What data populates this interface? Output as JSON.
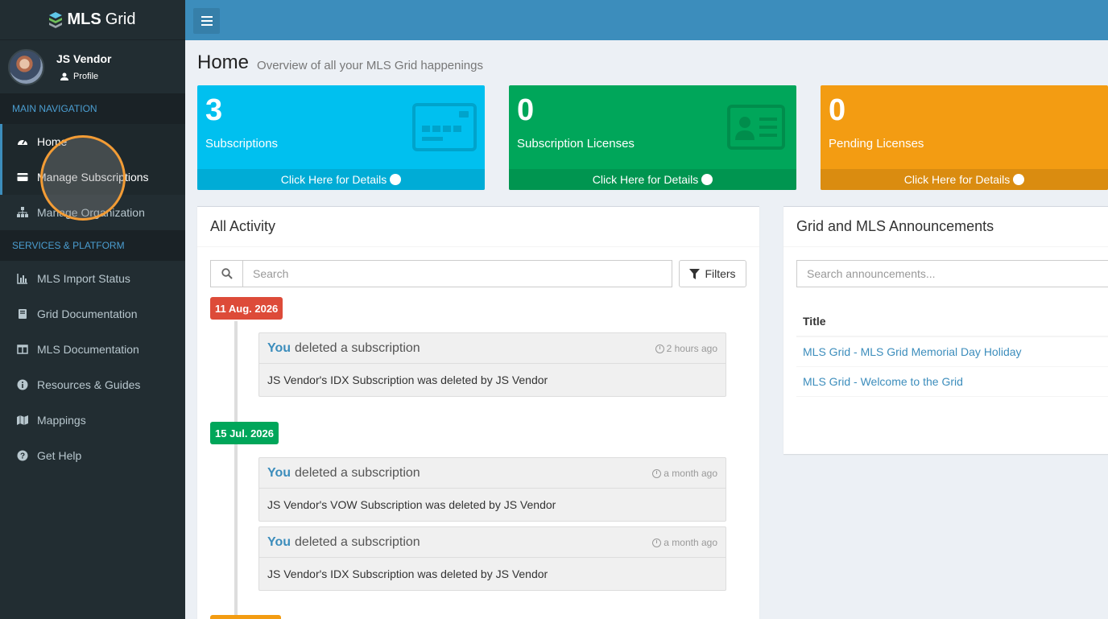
{
  "app": {
    "logo_bold": "MLS",
    "logo_rest": "Grid"
  },
  "user": {
    "name": "JS Vendor",
    "profile_label": "Profile"
  },
  "sidebar": {
    "main_header": "MAIN NAVIGATION",
    "main_items": [
      {
        "label": "Home",
        "icon": "dashboard-icon"
      },
      {
        "label": "Manage Subscriptions",
        "icon": "credit-card-icon"
      },
      {
        "label": "Manage Organization",
        "icon": "sitemap-icon"
      }
    ],
    "services_header": "SERVICES & PLATFORM",
    "services_items": [
      {
        "label": "MLS Import Status",
        "icon": "bar-chart-icon"
      },
      {
        "label": "Grid Documentation",
        "icon": "book-icon"
      },
      {
        "label": "MLS Documentation",
        "icon": "columns-icon"
      },
      {
        "label": "Resources & Guides",
        "icon": "info-circle-icon"
      },
      {
        "label": "Mappings",
        "icon": "map-icon"
      },
      {
        "label": "Get Help",
        "icon": "question-circle-icon"
      }
    ]
  },
  "header": {
    "title": "Home",
    "subtitle": "Overview of all your MLS Grid happenings"
  },
  "stat_boxes": [
    {
      "count": "3",
      "label": "Subscriptions",
      "link": "Click Here for Details",
      "color": "#00c0ef",
      "icon": "credit-card-icon"
    },
    {
      "count": "0",
      "label": "Subscription Licenses",
      "link": "Click Here for Details",
      "color": "#00a65a",
      "icon": "id-card-icon"
    },
    {
      "count": "0",
      "label": "Pending Licenses",
      "link": "Click Here for Details",
      "color": "#f39c12",
      "icon": "hourglass-icon"
    }
  ],
  "activity": {
    "title": "All Activity",
    "search_placeholder": "Search",
    "filters_label": "Filters",
    "groups": [
      {
        "date": "11 Aug. 2026",
        "color": "#dd4b39",
        "items": [
          {
            "actor": "You",
            "action": "deleted a subscription",
            "time": "2 hours ago",
            "detail": "JS Vendor's IDX Subscription was deleted by JS Vendor"
          }
        ]
      },
      {
        "date": "15 Jul. 2026",
        "color": "#00a65a",
        "items": [
          {
            "actor": "You",
            "action": "deleted a subscription",
            "time": "a month ago",
            "detail": "JS Vendor's VOW Subscription was deleted by JS Vendor"
          },
          {
            "actor": "You",
            "action": "deleted a subscription",
            "time": "a month ago",
            "detail": "JS Vendor's IDX Subscription was deleted by JS Vendor"
          }
        ]
      }
    ]
  },
  "announcements": {
    "title": "Grid and MLS Announcements",
    "search_placeholder": "Search announcements...",
    "column_title": "Title",
    "rows": [
      "MLS Grid - MLS Grid Memorial Day Holiday",
      "MLS Grid - Welcome to the Grid"
    ]
  },
  "colors": {
    "sidebar": "#222d32",
    "topbar": "#3c8dbc",
    "link": "#3c8dbc",
    "highlight_ring": "#f39c35"
  }
}
